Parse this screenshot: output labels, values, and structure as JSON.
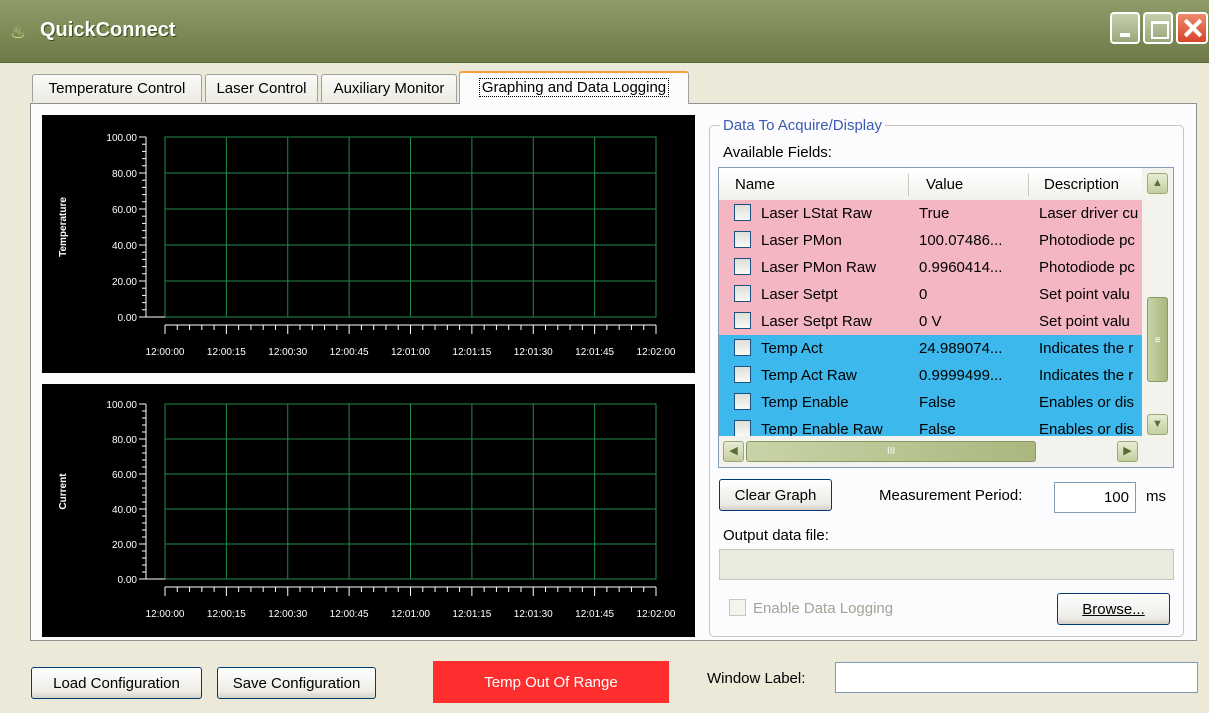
{
  "window": {
    "title": "QuickConnect"
  },
  "tabs": [
    {
      "label": "Temperature Control"
    },
    {
      "label": "Laser Control"
    },
    {
      "label": "Auxiliary Monitor"
    },
    {
      "label": "Graphing and Data Logging",
      "active": true
    }
  ],
  "chart_data": [
    {
      "type": "line",
      "title": "",
      "ylabel": "Temperature",
      "xlabel": "",
      "ylim": [
        0,
        100
      ],
      "yticks": [
        "100.00",
        "80.00",
        "60.00",
        "40.00",
        "20.00",
        "0.00"
      ],
      "xticks": [
        "12:00:00",
        "12:00:15",
        "12:00:30",
        "12:00:45",
        "12:01:00",
        "12:01:15",
        "12:01:30",
        "12:01:45",
        "12:02:00"
      ],
      "series": [],
      "grid": true,
      "grid_color": "#1f8a4a",
      "background": "#000000"
    },
    {
      "type": "line",
      "title": "",
      "ylabel": "Current",
      "xlabel": "",
      "ylim": [
        0,
        100
      ],
      "yticks": [
        "100.00",
        "80.00",
        "60.00",
        "40.00",
        "20.00",
        "0.00"
      ],
      "xticks": [
        "12:00:00",
        "12:00:15",
        "12:00:30",
        "12:00:45",
        "12:01:00",
        "12:01:15",
        "12:01:30",
        "12:01:45",
        "12:02:00"
      ],
      "series": [],
      "grid": true,
      "grid_color": "#1f8a4a",
      "background": "#000000"
    }
  ],
  "acquire": {
    "group_title": "Data To Acquire/Display",
    "available_label": "Available Fields:",
    "columns": {
      "name": "Name",
      "value": "Value",
      "description": "Description"
    },
    "rows": [
      {
        "name": "Laser LStat Raw",
        "value": "True",
        "description": "Laser driver cu",
        "color": "#f5b6c3"
      },
      {
        "name": "Laser PMon",
        "value": "100.07486...",
        "description": "Photodiode pc",
        "color": "#f5b6c3"
      },
      {
        "name": "Laser PMon Raw",
        "value": "0.9960414...",
        "description": "Photodiode pc",
        "color": "#f5b6c3"
      },
      {
        "name": "Laser Setpt",
        "value": "0",
        "description": "Set point valu",
        "color": "#f5b6c3"
      },
      {
        "name": "Laser Setpt Raw",
        "value": "0 V",
        "description": "Set point valu",
        "color": "#f5b6c3"
      },
      {
        "name": "Temp Act",
        "value": "24.989074...",
        "description": "Indicates the r",
        "color": "#3cb8ec"
      },
      {
        "name": "Temp Act Raw",
        "value": "0.9999499...",
        "description": "Indicates the r",
        "color": "#3cb8ec"
      },
      {
        "name": "Temp Enable",
        "value": "False",
        "description": "Enables or dis",
        "color": "#3cb8ec"
      },
      {
        "name": "Temp Enable Raw",
        "value": "False",
        "description": "Enables or dis",
        "color": "#3cb8ec"
      }
    ],
    "scroll_grip": "III",
    "clear_graph": "Clear Graph",
    "measurement_label": "Measurement Period:",
    "measurement_value": "100",
    "measurement_unit": "ms",
    "output_label": "Output data file:",
    "output_value": "",
    "enable_logging": "Enable Data Logging",
    "browse": "Browse..."
  },
  "footer": {
    "load": "Load Configuration",
    "save": "Save Configuration",
    "status": "Temp Out Of Range",
    "status_color": "#ff2e2e",
    "window_label": "Window Label:",
    "window_label_value": ""
  }
}
